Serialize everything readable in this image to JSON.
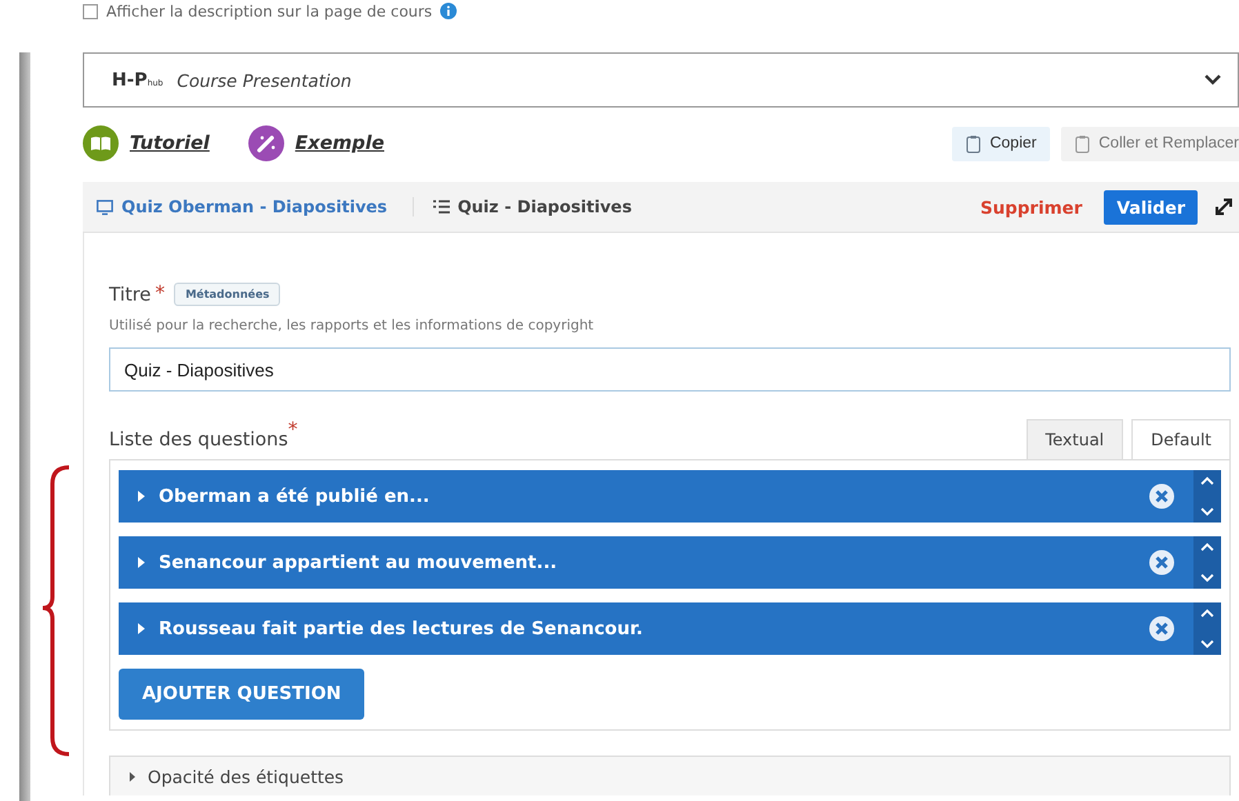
{
  "display_option": {
    "label": "Afficher la description sur la page de cours",
    "checked": false
  },
  "content_type": {
    "logo": "H-P",
    "logo_sub": "hub",
    "name": "Course Presentation",
    "expanded": false
  },
  "links": [
    {
      "label": "Tutoriel",
      "kind": "tutorial"
    },
    {
      "label": "Exemple",
      "kind": "example"
    }
  ],
  "actions": [
    {
      "label": "Copier",
      "disabled": false
    },
    {
      "label": "Coller et Remplacer",
      "disabled": true
    }
  ],
  "breadcrumb": [
    {
      "label": "Quiz Oberman - Diapositives",
      "kind": "presentation"
    },
    {
      "label": "Quiz - Diapositives",
      "kind": "list"
    }
  ],
  "header_buttons": {
    "delete": "Supprimer",
    "confirm": "Valider"
  },
  "title_field": {
    "label": "Titre",
    "required_mark": "*",
    "badge": "Métadonnées",
    "hint": "Utilisé pour la recherche, les rapports et les informations de copyright",
    "value": "Quiz - Diapositives"
  },
  "questions": {
    "label": "Liste des questions",
    "required_mark": "*",
    "tabs": [
      {
        "label": "Textual",
        "selected": false
      },
      {
        "label": "Default",
        "selected": true
      }
    ],
    "items": [
      {
        "label": "Oberman a été publié en...",
        "expanded": false
      },
      {
        "label": "Senancour appartient au mouvement...",
        "expanded": false
      },
      {
        "label": "Rousseau fait partie des lectures de Senancour.",
        "expanded": false
      }
    ],
    "add_button": "AJOUTER QUESTION"
  },
  "collapsed_sections": [
    {
      "label": "Opacité des étiquettes",
      "expanded": false
    }
  ]
}
